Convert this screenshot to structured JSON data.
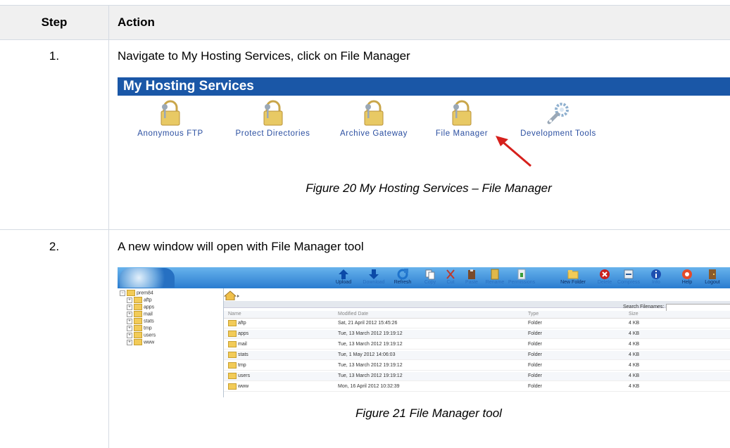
{
  "table": {
    "header": {
      "step": "Step",
      "action": "Action"
    },
    "rows": [
      {
        "step": "1.",
        "action": "Navigate to My Hosting Services, click on File Manager",
        "caption": "Figure 20 My Hosting Services – File Manager"
      },
      {
        "step": "2.",
        "action": "A new window will open with File Manager tool",
        "caption": "Figure 21 File Manager tool"
      }
    ]
  },
  "hosting": {
    "title": "My Hosting Services",
    "tools": [
      {
        "label": "Anonymous FTP",
        "icon": "lock-key-icon"
      },
      {
        "label": "Protect Directories",
        "icon": "lock-key-icon"
      },
      {
        "label": "Archive Gateway",
        "icon": "lock-key-icon"
      },
      {
        "label": "File Manager",
        "icon": "lock-key-icon"
      },
      {
        "label": "Development Tools",
        "icon": "wrench-gear-icon"
      }
    ],
    "accent": "#1a57a7",
    "arrow_color": "#d6201c"
  },
  "file_manager": {
    "toolbar": [
      {
        "label": "Upload",
        "icon": "upload-icon"
      },
      {
        "label": "Download",
        "icon": "download-icon"
      },
      {
        "label": "Refresh",
        "icon": "refresh-icon"
      },
      {
        "label": "Copy",
        "icon": "copy-icon"
      },
      {
        "label": "Cut",
        "icon": "cut-icon"
      },
      {
        "label": "Paste",
        "icon": "paste-icon"
      },
      {
        "label": "Rename",
        "icon": "rename-icon"
      },
      {
        "label": "Permissions",
        "icon": "permissions-icon"
      },
      {
        "label": "New Folder",
        "icon": "new-folder-icon"
      },
      {
        "label": "Delete",
        "icon": "delete-icon"
      },
      {
        "label": "Compress",
        "icon": "compress-icon"
      },
      {
        "label": "Info",
        "icon": "info-icon"
      },
      {
        "label": "Help",
        "icon": "help-icon"
      },
      {
        "label": "Logout",
        "icon": "logout-icon"
      }
    ],
    "tree": {
      "root": "prem84",
      "children": [
        "aftp",
        "apps",
        "mail",
        "stats",
        "tmp",
        "users",
        "www"
      ]
    },
    "search_label": "Search Filenames:",
    "columns": [
      "Name",
      "Modified Date",
      "Type",
      "Size"
    ],
    "files": [
      {
        "name": "aftp",
        "modified": "Sat, 21 April 2012 15:45:26",
        "type": "Folder",
        "size": "4 KB"
      },
      {
        "name": "apps",
        "modified": "Tue, 13 March 2012 19:19:12",
        "type": "Folder",
        "size": "4 KB"
      },
      {
        "name": "mail",
        "modified": "Tue, 13 March 2012 19:19:12",
        "type": "Folder",
        "size": "4 KB"
      },
      {
        "name": "stats",
        "modified": "Tue, 1 May 2012 14:06:03",
        "type": "Folder",
        "size": "4 KB"
      },
      {
        "name": "tmp",
        "modified": "Tue, 13 March 2012 19:19:12",
        "type": "Folder",
        "size": "4 KB"
      },
      {
        "name": "users",
        "modified": "Tue, 13 March 2012 19:19:12",
        "type": "Folder",
        "size": "4 KB"
      },
      {
        "name": "www",
        "modified": "Mon, 16 April 2012 10:32:39",
        "type": "Folder",
        "size": "4 KB"
      }
    ]
  }
}
